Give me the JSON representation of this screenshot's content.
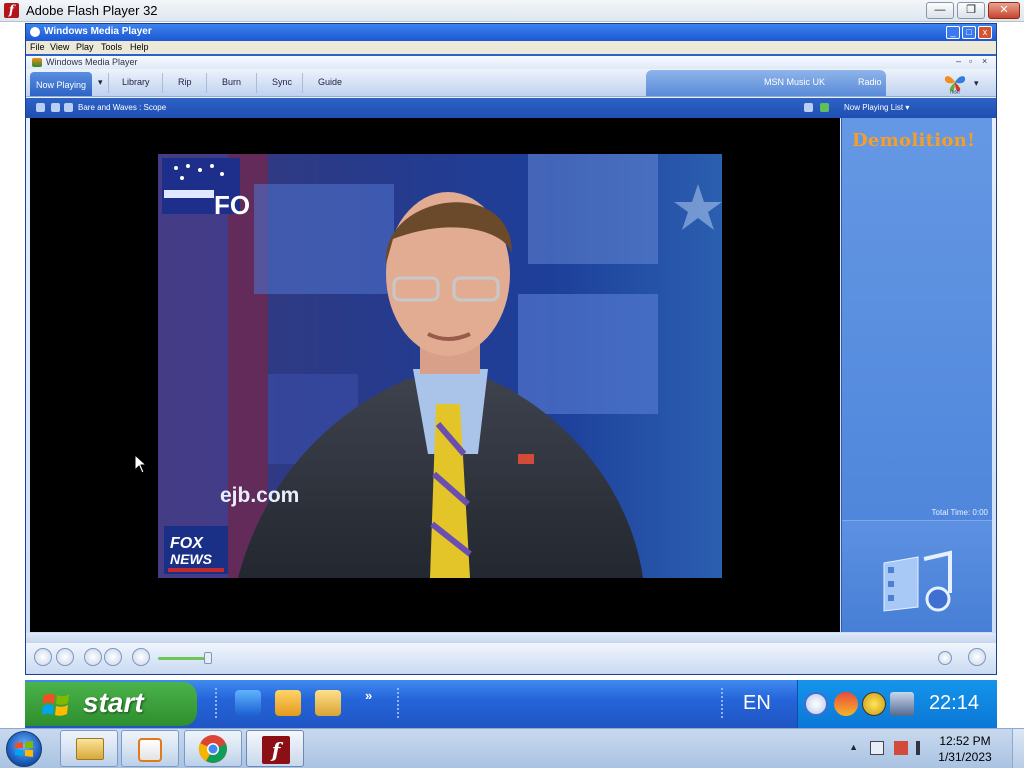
{
  "flash_window": {
    "title": "Adobe Flash Player 32",
    "buttons": {
      "minimize": "—",
      "maximize": "❐",
      "close": "✕"
    }
  },
  "wmp": {
    "window_title": "Windows Media Player",
    "menu": [
      "File",
      "View",
      "Play",
      "Tools",
      "Help"
    ],
    "inner_title": "Windows Media Player",
    "tabs": [
      "Now Playing",
      "Library",
      "Rip",
      "Burn",
      "Sync",
      "Guide"
    ],
    "right_tabs": [
      "MSN Music UK",
      "Radio"
    ],
    "msn_label": "msn",
    "track": "Bare and Waves : Scope",
    "now_playing_list": "Now Playing List",
    "playlist_title": "Demolition!",
    "total_time": "Total Time: 0:00",
    "video_overlay_text": "ejb.com",
    "video_logo_fo": "FO",
    "video_logo_fox": "FOX",
    "video_logo_news": "NEWS"
  },
  "xp_taskbar": {
    "start_label": "start",
    "chevron": "»",
    "language": "EN",
    "clock": "22:14"
  },
  "win7_taskbar": {
    "time": "12:52 PM",
    "date": "1/31/2023",
    "tray_arrow": "▲"
  }
}
